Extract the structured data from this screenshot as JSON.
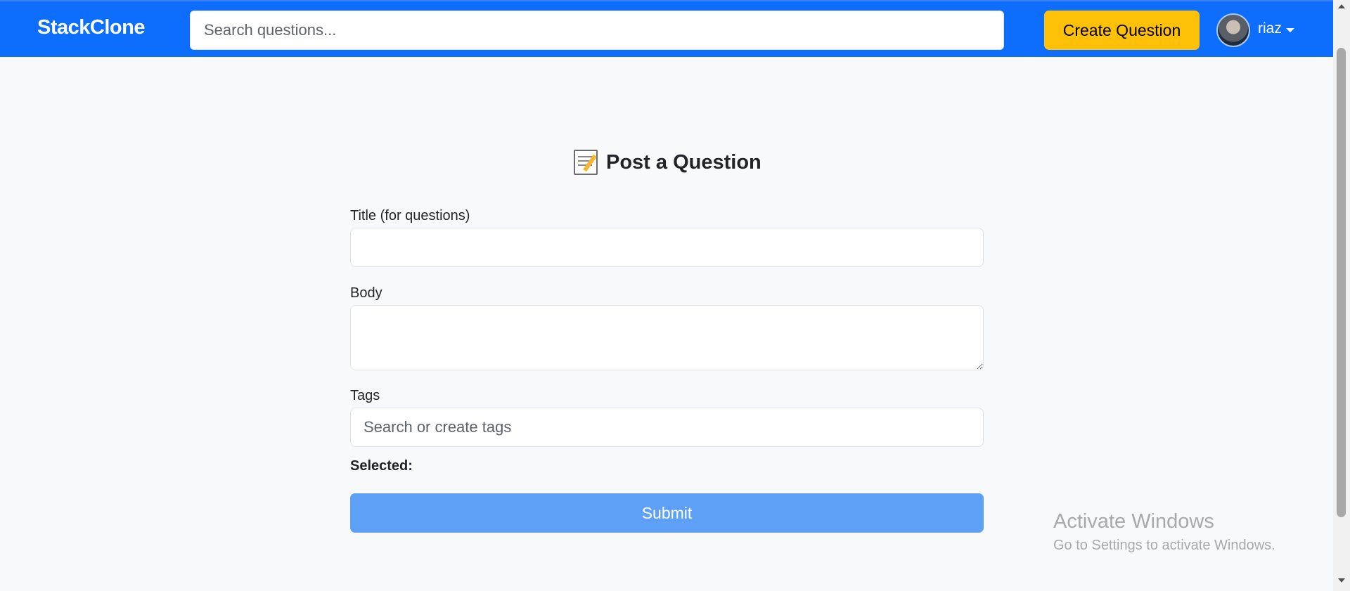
{
  "navbar": {
    "brand": "StackClone",
    "search_placeholder": "Search questions...",
    "create_button": "Create Question",
    "username": "riaz",
    "bg_color": "#0d6efd",
    "accent_color": "#ffc107"
  },
  "form": {
    "heading": "Post a Question",
    "heading_icon": "memo-icon",
    "title_label": "Title (for questions)",
    "title_value": "",
    "body_label": "Body",
    "body_value": "",
    "tags_label": "Tags",
    "tags_placeholder": "Search or create tags",
    "selected_label": "Selected:",
    "submit_label": "Submit",
    "submit_color": "#5fa0f7"
  },
  "watermark": {
    "title": "Activate Windows",
    "subtitle": "Go to Settings to activate Windows."
  }
}
